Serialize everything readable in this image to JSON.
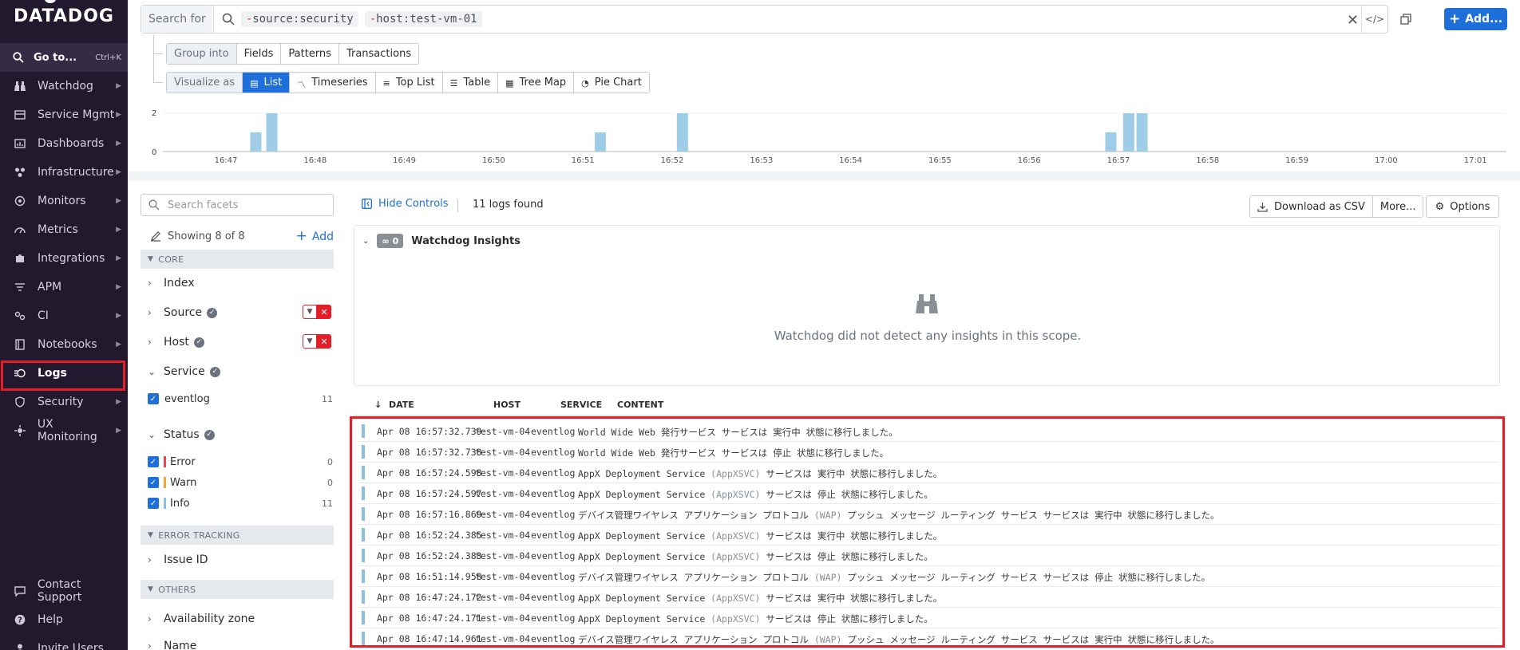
{
  "sidebar": {
    "brand": "DATADOG",
    "goto": {
      "label": "Go to...",
      "shortcut": "Ctrl+K"
    },
    "items": [
      {
        "label": "Watchdog",
        "icon": "binoculars-icon"
      },
      {
        "label": "Service Mgmt",
        "icon": "service-icon"
      },
      {
        "label": "Dashboards",
        "icon": "dashboard-icon"
      },
      {
        "label": "Infrastructure",
        "icon": "infrastructure-icon"
      },
      {
        "label": "Monitors",
        "icon": "monitor-icon"
      },
      {
        "label": "Metrics",
        "icon": "metrics-icon"
      },
      {
        "label": "Integrations",
        "icon": "puzzle-icon"
      },
      {
        "label": "APM",
        "icon": "apm-icon"
      },
      {
        "label": "CI",
        "icon": "ci-icon"
      },
      {
        "label": "Notebooks",
        "icon": "notebook-icon"
      },
      {
        "label": "Logs",
        "icon": "logs-icon",
        "active": true
      },
      {
        "label": "Security",
        "icon": "shield-icon"
      },
      {
        "label": "UX Monitoring",
        "icon": "ux-icon"
      }
    ],
    "bottom": [
      {
        "label": "Contact Support",
        "icon": "chat-icon"
      },
      {
        "label": "Help",
        "icon": "help-icon"
      },
      {
        "label": "Invite Users",
        "icon": "user-icon"
      }
    ]
  },
  "search": {
    "prefix": "Search for",
    "chips": [
      {
        "neg": "-",
        "text": "source:security"
      },
      {
        "neg": "-",
        "text": "host:test-vm-01"
      }
    ]
  },
  "top_buttons": {
    "add": "Add..."
  },
  "group_into": {
    "label": "Group into",
    "options": [
      "Fields",
      "Patterns",
      "Transactions"
    ]
  },
  "visualize_as": {
    "label": "Visualize as",
    "options": [
      "List",
      "Timeseries",
      "Top List",
      "Table",
      "Tree Map",
      "Pie Chart"
    ],
    "selected": "List"
  },
  "histogram": {
    "y_ticks": [
      "2",
      "0"
    ],
    "x_ticks": [
      "16:47",
      "16:48",
      "16:49",
      "16:50",
      "16:51",
      "16:52",
      "16:53",
      "16:54",
      "16:55",
      "16:56",
      "16:57",
      "16:58",
      "16:59",
      "17:00",
      "17:01"
    ],
    "bar_color": "#9fcce6",
    "bars": [
      {
        "minute": 16.62,
        "count": 1
      },
      {
        "minute": 16.8,
        "count": 2
      },
      {
        "minute": 16.48,
        "count": 1,
        "t": 51
      },
      {
        "minute": 16.4,
        "count": 2,
        "t": 52
      },
      {
        "minute": 16.2,
        "count": 1,
        "t": 57
      },
      {
        "minute": 16.4,
        "count": 2,
        "t": 57
      },
      {
        "minute": 16.55,
        "count": 2,
        "t": 57
      }
    ]
  },
  "facets": {
    "search_placeholder": "Search facets",
    "showing": "Showing 8 of 8",
    "add": "Add",
    "sections": {
      "core": "CORE",
      "error_tracking": "ERROR TRACKING",
      "others": "OTHERS"
    },
    "index": "Index",
    "source": "Source",
    "host": "Host",
    "service": "Service",
    "service_items": [
      {
        "label": "eventlog",
        "count": "11"
      }
    ],
    "status": "Status",
    "status_items": [
      {
        "label": "Error",
        "count": "0",
        "color": "#e5484d"
      },
      {
        "label": "Warn",
        "count": "0",
        "color": "#f2a33a"
      },
      {
        "label": "Info",
        "count": "11",
        "color": "#8fbfe0"
      }
    ],
    "issue_id": "Issue ID",
    "availability_zone": "Availability zone",
    "name": "Name"
  },
  "controls": {
    "hide": "Hide Controls",
    "found": "11 logs found",
    "csv": "Download as CSV",
    "more": "More...",
    "options": "Options"
  },
  "insights": {
    "count": "0",
    "title": "Watchdog Insights",
    "empty": "Watchdog did not detect any insights in this scope."
  },
  "table": {
    "headers": {
      "date": "DATE",
      "host": "HOST",
      "service": "SERVICE",
      "content": "CONTENT"
    },
    "rows": [
      {
        "date": "Apr 08 16:57:32.739",
        "host": "test-vm-04",
        "service": "eventlog",
        "pre": "World Wide Web 発行サービス サービスは 実行中 状態に移行しました。",
        "dim": "",
        "post": ""
      },
      {
        "date": "Apr 08 16:57:32.738",
        "host": "test-vm-04",
        "service": "eventlog",
        "pre": "World Wide Web 発行サービス サービスは 停止 状態に移行しました。",
        "dim": "",
        "post": ""
      },
      {
        "date": "Apr 08 16:57:24.598",
        "host": "test-vm-04",
        "service": "eventlog",
        "pre": "AppX Deployment Service ",
        "dim": "(AppXSVC)",
        "post": " サービスは 実行中 状態に移行しました。"
      },
      {
        "date": "Apr 08 16:57:24.597",
        "host": "test-vm-04",
        "service": "eventlog",
        "pre": "AppX Deployment Service ",
        "dim": "(AppXSVC)",
        "post": " サービスは 停止 状態に移行しました。"
      },
      {
        "date": "Apr 08 16:57:16.869",
        "host": "test-vm-04",
        "service": "eventlog",
        "pre": "デバイス管理ワイヤレス アプリケーション プロトコル ",
        "dim": "(WAP)",
        "post": " プッシュ メッセージ ルーティング サービス サービスは 実行中 状態に移行しました。"
      },
      {
        "date": "Apr 08 16:52:24.385",
        "host": "test-vm-04",
        "service": "eventlog",
        "pre": "AppX Deployment Service ",
        "dim": "(AppXSVC)",
        "post": " サービスは 実行中 状態に移行しました。"
      },
      {
        "date": "Apr 08 16:52:24.383",
        "host": "test-vm-04",
        "service": "eventlog",
        "pre": "AppX Deployment Service ",
        "dim": "(AppXSVC)",
        "post": " サービスは 停止 状態に移行しました。"
      },
      {
        "date": "Apr 08 16:51:14.958",
        "host": "test-vm-04",
        "service": "eventlog",
        "pre": "デバイス管理ワイヤレス アプリケーション プロトコル ",
        "dim": "(WAP)",
        "post": " プッシュ メッセージ ルーティング サービス サービスは 停止 状態に移行しました。"
      },
      {
        "date": "Apr 08 16:47:24.172",
        "host": "test-vm-04",
        "service": "eventlog",
        "pre": "AppX Deployment Service ",
        "dim": "(AppXSVC)",
        "post": " サービスは 実行中 状態に移行しました。"
      },
      {
        "date": "Apr 08 16:47:24.171",
        "host": "test-vm-04",
        "service": "eventlog",
        "pre": "AppX Deployment Service ",
        "dim": "(AppXSVC)",
        "post": " サービスは 停止 状態に移行しました。"
      },
      {
        "date": "Apr 08 16:47:14.961",
        "host": "test-vm-04",
        "service": "eventlog",
        "pre": "デバイス管理ワイヤレス アプリケーション プロトコル ",
        "dim": "(WAP)",
        "post": " プッシュ メッセージ ルーティング サービス サービスは 実行中 状態に移行しました。"
      }
    ]
  }
}
